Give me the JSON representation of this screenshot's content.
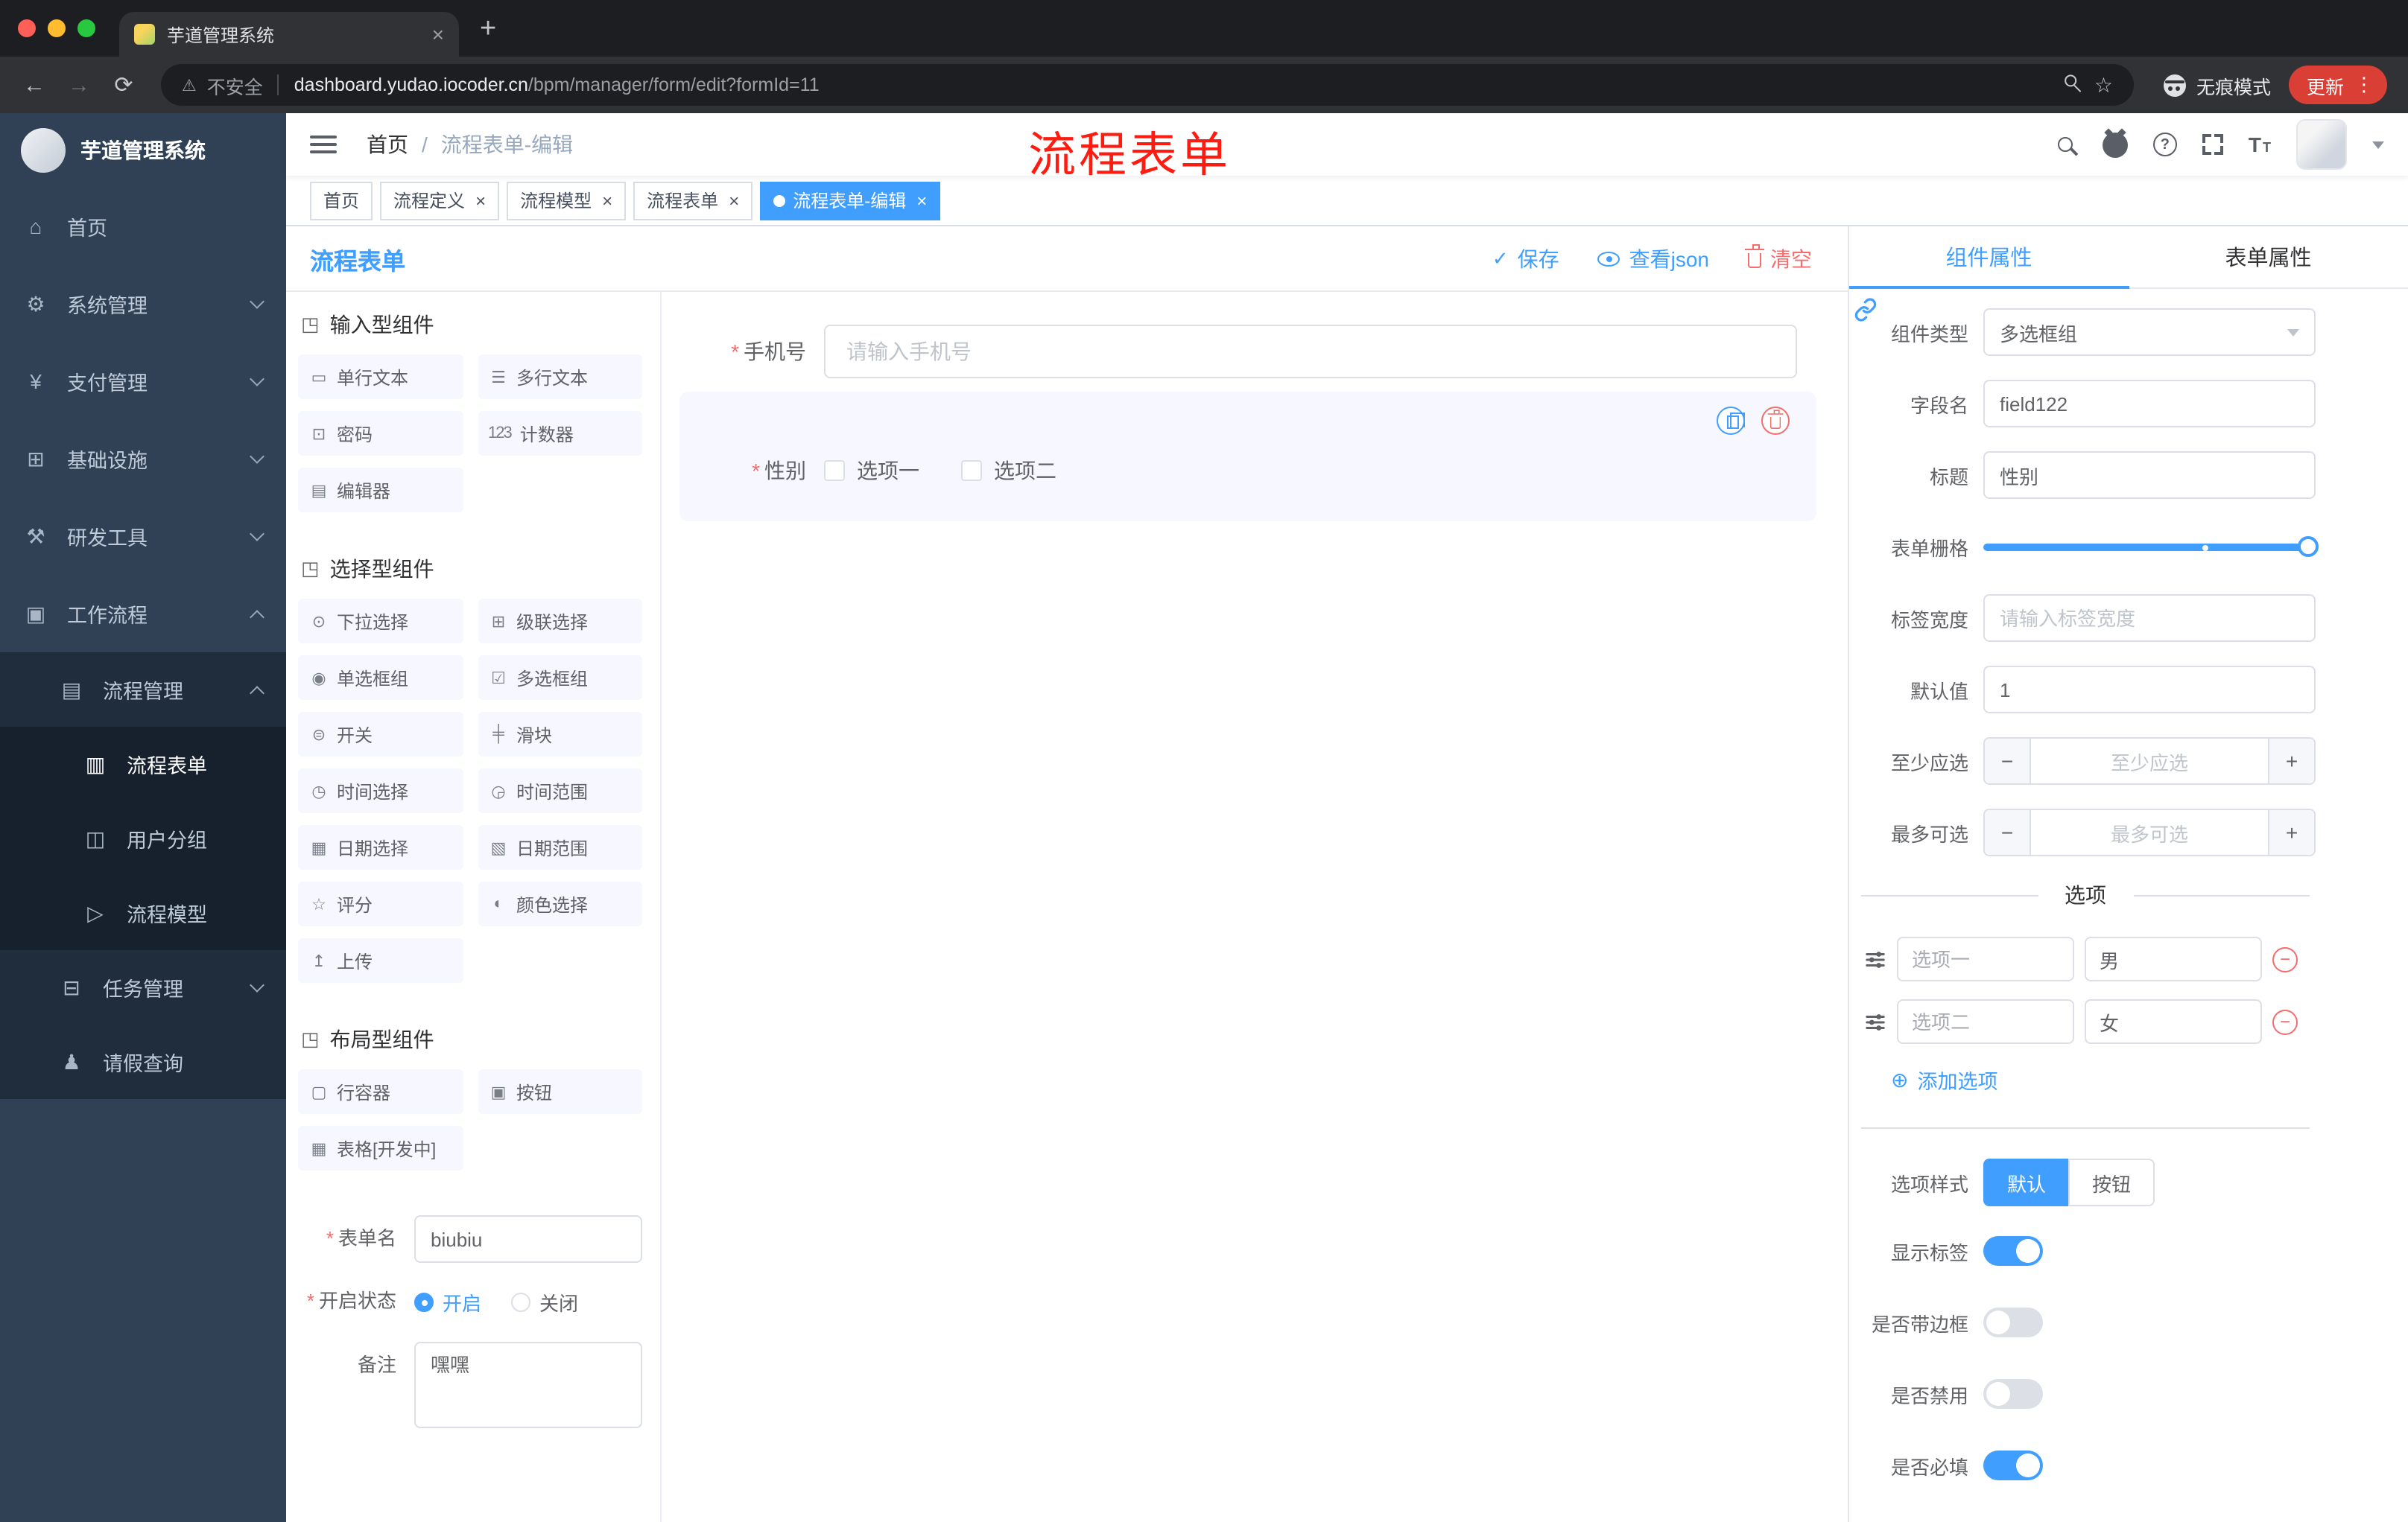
{
  "theme": {
    "accent": "#409EFF",
    "danger": "#F56C6C",
    "sidebar_bg": "#304156",
    "annotation_red": "#FE1B10"
  },
  "icons": {
    "close": "×",
    "plus": "+",
    "minus": "−",
    "back": "←",
    "forward": "→",
    "reload": "⟳",
    "warning": "⚠",
    "star": "☆",
    "dots": "⋮",
    "question": "?",
    "font_big": "T",
    "font_small": "T",
    "check": "✓",
    "section": "◳",
    "asterisk": "*",
    "add_circle": "⊕"
  },
  "browser": {
    "tab_title": "芋道管理系统",
    "not_secure": "不安全",
    "url_host": "dashboard.yudao.iocoder.cn",
    "url_path": "/bpm/manager/form/edit?formId=11",
    "incognito_label": "无痕模式",
    "update_label": "更新"
  },
  "sidebar": {
    "app_title": "芋道管理系统",
    "items": [
      {
        "label": "首页",
        "glyph": "⌂"
      },
      {
        "label": "系统管理",
        "glyph": "⚙"
      },
      {
        "label": "支付管理",
        "glyph": "¥"
      },
      {
        "label": "基础设施",
        "glyph": "⊞"
      },
      {
        "label": "研发工具",
        "glyph": "⚒"
      },
      {
        "label": "工作流程",
        "glyph": "▣"
      },
      {
        "label": "流程管理",
        "glyph": "▤"
      },
      {
        "label": "流程表单",
        "glyph": "▥"
      },
      {
        "label": "用户分组",
        "glyph": "◫"
      },
      {
        "label": "流程模型",
        "glyph": "▷"
      },
      {
        "label": "任务管理",
        "glyph": "⊟"
      },
      {
        "label": "请假查询",
        "glyph": "♟"
      }
    ]
  },
  "header": {
    "breadcrumb_home": "首页",
    "breadcrumb_sep": "/",
    "breadcrumb_current": "流程表单-编辑",
    "annotation": "流程表单"
  },
  "tags": [
    {
      "label": "首页"
    },
    {
      "label": "流程定义"
    },
    {
      "label": "流程模型"
    },
    {
      "label": "流程表单"
    },
    {
      "label": "流程表单-编辑"
    }
  ],
  "designer": {
    "title": "流程表单",
    "save_label": "保存",
    "view_json_label": "查看json",
    "clear_label": "清空",
    "sections": [
      {
        "title": "输入型组件",
        "items": [
          {
            "label": "单行文本",
            "glyph": "▭"
          },
          {
            "label": "多行文本",
            "glyph": "☰"
          },
          {
            "label": "密码",
            "glyph": "⊡"
          },
          {
            "label": "计数器",
            "glyph": "123"
          },
          {
            "label": "编辑器",
            "glyph": "▤"
          }
        ]
      },
      {
        "title": "选择型组件",
        "items": [
          {
            "label": "下拉选择",
            "glyph": "⊙"
          },
          {
            "label": "级联选择",
            "glyph": "⊞"
          },
          {
            "label": "单选框组",
            "glyph": "◉"
          },
          {
            "label": "多选框组",
            "glyph": "☑"
          },
          {
            "label": "开关",
            "glyph": "⊜"
          },
          {
            "label": "滑块",
            "glyph": "╪"
          },
          {
            "label": "时间选择",
            "glyph": "◷"
          },
          {
            "label": "时间范围",
            "glyph": "◶"
          },
          {
            "label": "日期选择",
            "glyph": "▦"
          },
          {
            "label": "日期范围",
            "glyph": "▧"
          },
          {
            "label": "评分",
            "glyph": "☆"
          },
          {
            "label": "颜色选择",
            "glyph": "◐"
          },
          {
            "label": "上传",
            "glyph": "↥"
          }
        ]
      },
      {
        "title": "布局型组件",
        "items": [
          {
            "label": "行容器",
            "glyph": "▢"
          },
          {
            "label": "按钮",
            "glyph": "▣"
          },
          {
            "label": "表格[开发中]",
            "glyph": "▦"
          }
        ]
      }
    ],
    "meta": {
      "form_name_label": "表单名",
      "form_name_value": "biubiu",
      "status_label": "开启状态",
      "status_on": "开启",
      "status_off": "关闭",
      "remark_label": "备注",
      "remark_value": "嘿嘿"
    },
    "canvas": {
      "phone_label": "手机号",
      "phone_placeholder": "请输入手机号",
      "gender_label": "性别",
      "gender_opt1": "选项一",
      "gender_opt2": "选项二"
    }
  },
  "panel": {
    "tab_component": "组件属性",
    "tab_form": "表单属性",
    "component_type_label": "组件类型",
    "component_type_value": "多选框组",
    "field_name_label": "字段名",
    "field_name_value": "field122",
    "title_label": "标题",
    "title_value": "性别",
    "grid_label": "表单栅格",
    "label_width_label": "标签宽度",
    "label_width_placeholder": "请输入标签宽度",
    "default_label": "默认值",
    "default_value": "1",
    "min_label": "至少应选",
    "min_placeholder": "至少应选",
    "max_label": "最多可选",
    "max_placeholder": "最多可选",
    "options_divider": "选项",
    "options": [
      {
        "label": "选项一",
        "value": "男"
      },
      {
        "label": "选项二",
        "value": "女"
      }
    ],
    "add_option": "添加选项",
    "style_label": "选项样式",
    "style_default": "默认",
    "style_button": "按钮",
    "show_label": "显示标签",
    "border_label": "是否带边框",
    "disabled_label": "是否禁用",
    "required_label": "是否必填"
  }
}
